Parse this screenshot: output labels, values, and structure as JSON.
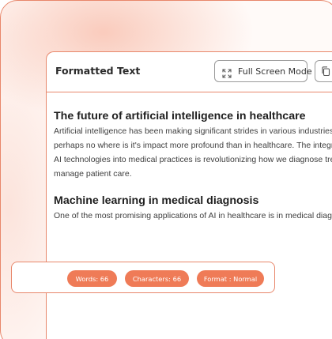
{
  "panel": {
    "title": "Formatted Text",
    "fullscreen_label": "Full Screen Mode",
    "icons": {
      "fullscreen": "expand-corners-icon",
      "copy": "copy-icon"
    }
  },
  "document": {
    "sections": [
      {
        "heading": "The future of artificial intelligence in healthcare",
        "lines": [
          "Artificial intelligence has been making significant strides in various industries,",
          "perhaps no where is it's impact more profound than in healthcare. The integration of",
          "AI technologies into medical practices is revolutionizing how we diagnose treat and",
          "manage patient care."
        ]
      },
      {
        "heading": "Machine learning in medical diagnosis",
        "lines": [
          "One of the most promising applications of AI in healthcare is in medical diagnosis."
        ]
      }
    ]
  },
  "stats": {
    "words": "Words: 66",
    "characters": "Characters: 66",
    "format": "Format : Normal"
  },
  "colors": {
    "accent": "#ef7b57",
    "border": "#e8876b"
  }
}
